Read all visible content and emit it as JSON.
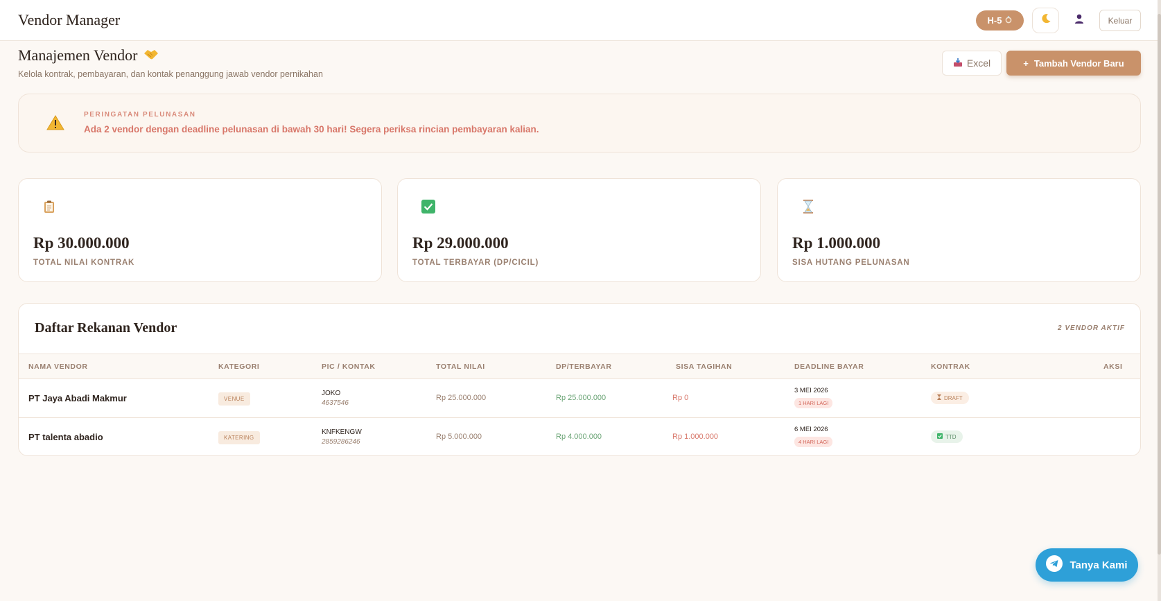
{
  "app": {
    "brand": "Vendor Manager",
    "countdown": "H-5",
    "countdown_icon": "ring-icon",
    "logout_label": "Keluar"
  },
  "header": {
    "title": "Manajemen Vendor",
    "title_icon": "handshake-icon",
    "subtitle": "Kelola kontrak, pembayaran, dan kontak penanggung jawab vendor pernikahan",
    "excel_label": "Excel",
    "add_label": "Tambah Vendor Baru",
    "add_prefix": "+"
  },
  "alert": {
    "title": "PERINGATAN PELUNASAN",
    "message": "Ada 2 vendor dengan deadline pelunasan di bawah 30 hari! Segera periksa rincian pembayaran kalian."
  },
  "stats": [
    {
      "value": "Rp 30.000.000",
      "label": "TOTAL NILAI KONTRAK",
      "icon": "clipboard-icon"
    },
    {
      "value": "Rp 29.000.000",
      "label": "TOTAL TERBAYAR (DP/CICIL)",
      "icon": "checkmark-icon"
    },
    {
      "value": "Rp 1.000.000",
      "label": "SISA HUTANG PELUNASAN",
      "icon": "hourglass-icon"
    }
  ],
  "table": {
    "title": "Daftar Rekanan Vendor",
    "count": "2 VENDOR AKTIF",
    "headers": {
      "name": "NAMA VENDOR",
      "category": "KATEGORI",
      "pic": "PIC / KONTAK",
      "total": "TOTAL NILAI",
      "paid": "DP/TERBAYAR",
      "remaining": "SISA TAGIHAN",
      "deadline": "DEADLINE BAYAR",
      "contract": "KONTRAK",
      "action": "AKSI"
    },
    "rows": [
      {
        "name": "PT Jaya Abadi Makmur",
        "category": "VENUE",
        "pic_name": "JOKO",
        "pic_phone": "4637546",
        "total": "Rp 25.000.000",
        "paid": "Rp 25.000.000",
        "remaining": "Rp 0",
        "deadline": "3 MEI 2026",
        "deadline_badge": "1 HARI LAGI",
        "contract": "DRAFT",
        "contract_icon": "hourglass-icon"
      },
      {
        "name": "PT talenta abadio",
        "category": "KATERING",
        "pic_name": "KNFKENGW",
        "pic_phone": "2859286246",
        "total": "Rp 5.000.000",
        "paid": "Rp 4.000.000",
        "remaining": "Rp 1.000.000",
        "deadline": "6 MEI 2026",
        "deadline_badge": "4 HARI LAGI",
        "contract": "TTD",
        "contract_icon": "checkmark-icon"
      }
    ]
  },
  "chat": {
    "label": "Tanya Kami",
    "icon": "telegram-icon"
  },
  "colors": {
    "accent": "#c9926a",
    "background": "#fcf8f4",
    "alert_text": "#d8776a",
    "paid_green": "#6aa475",
    "chat_blue": "#2ea0d8"
  }
}
